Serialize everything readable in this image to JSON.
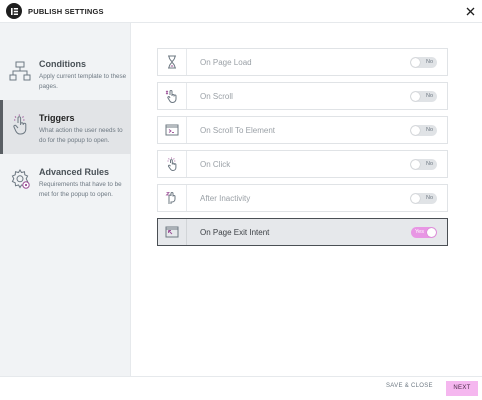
{
  "header": {
    "title": "PUBLISH SETTINGS"
  },
  "sidebar": {
    "items": [
      {
        "label": "Conditions",
        "description": "Apply current template to these pages.",
        "icon": "sitemap-icon",
        "active": false
      },
      {
        "label": "Triggers",
        "description": "What action the user needs to do for the popup to open.",
        "icon": "hand-click-icon",
        "active": true
      },
      {
        "label": "Advanced Rules",
        "description": "Requirements that have to be met for the popup to open.",
        "icon": "gear-icon",
        "active": false
      }
    ]
  },
  "triggers": [
    {
      "label": "On Page Load",
      "icon": "hourglass-icon",
      "toggle": "No",
      "active": false
    },
    {
      "label": "On Scroll",
      "icon": "scroll-hand-icon",
      "toggle": "No",
      "active": false
    },
    {
      "label": "On Scroll To Element",
      "icon": "scroll-element-icon",
      "toggle": "No",
      "active": false
    },
    {
      "label": "On Click",
      "icon": "click-icon",
      "toggle": "No",
      "active": false
    },
    {
      "label": "After Inactivity",
      "icon": "inactivity-icon",
      "toggle": "No",
      "active": false
    },
    {
      "label": "On Page Exit Intent",
      "icon": "exit-intent-icon",
      "toggle": "Yes",
      "active": true
    }
  ],
  "footer": {
    "save_label": "SAVE & CLOSE",
    "next_label": "NEXT"
  },
  "colors": {
    "accent": "#f5b7ef",
    "toggle_on": "#e896e4",
    "sidebar_bg": "#f1f3f5",
    "icon_purple": "#9b4f96"
  }
}
